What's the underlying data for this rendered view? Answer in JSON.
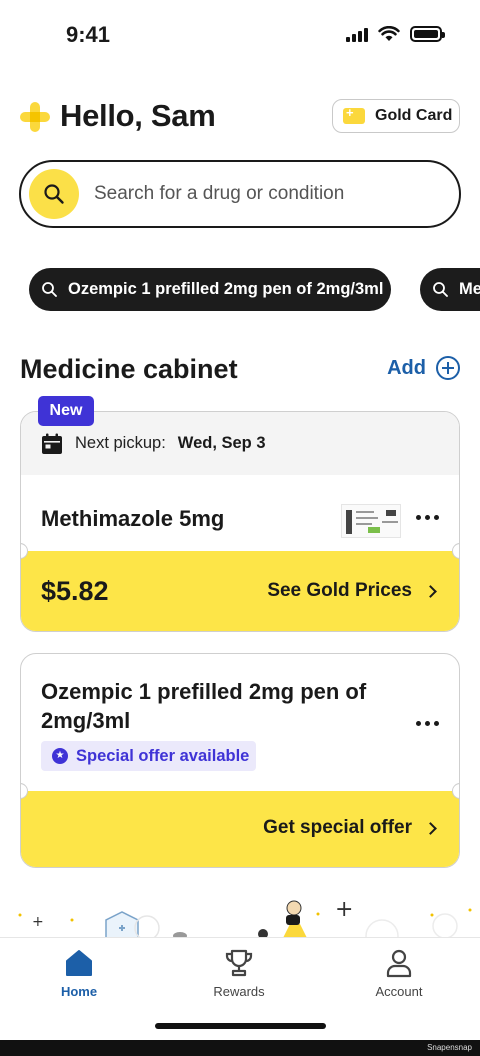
{
  "status_bar": {
    "time": "9:41"
  },
  "header": {
    "greeting": "Hello, Sam",
    "gold_card_label": "Gold Card"
  },
  "search": {
    "placeholder": "Search for a drug or condition"
  },
  "recent_searches": [
    {
      "label": "Ozempic 1 prefilled 2mg pen of 2mg/3ml"
    },
    {
      "label": "Me"
    }
  ],
  "medicine_cabinet": {
    "title": "Medicine cabinet",
    "add_label": "Add",
    "items": [
      {
        "badge": "New",
        "pickup_label": "Next pickup:",
        "pickup_date": "Wed, Sep 3",
        "name": "Methimazole 5mg",
        "price": "$5.82",
        "action_label": "See Gold Prices"
      },
      {
        "name": "Ozempic 1 prefilled 2mg pen of 2mg/3ml",
        "offer_label": "Special offer available",
        "action_label": "Get special offer"
      }
    ]
  },
  "tab_bar": {
    "tabs": [
      {
        "label": "Home",
        "icon": "home-icon",
        "active": true
      },
      {
        "label": "Rewards",
        "icon": "trophy-icon",
        "active": false
      },
      {
        "label": "Account",
        "icon": "person-icon",
        "active": false
      }
    ]
  },
  "watermark": "Snapensnap",
  "colors": {
    "brand_yellow": "#fde548",
    "accent_blue": "#1c5fa8",
    "badge_purple": "#3f33d6",
    "chip_dark": "#1c1c1c"
  }
}
